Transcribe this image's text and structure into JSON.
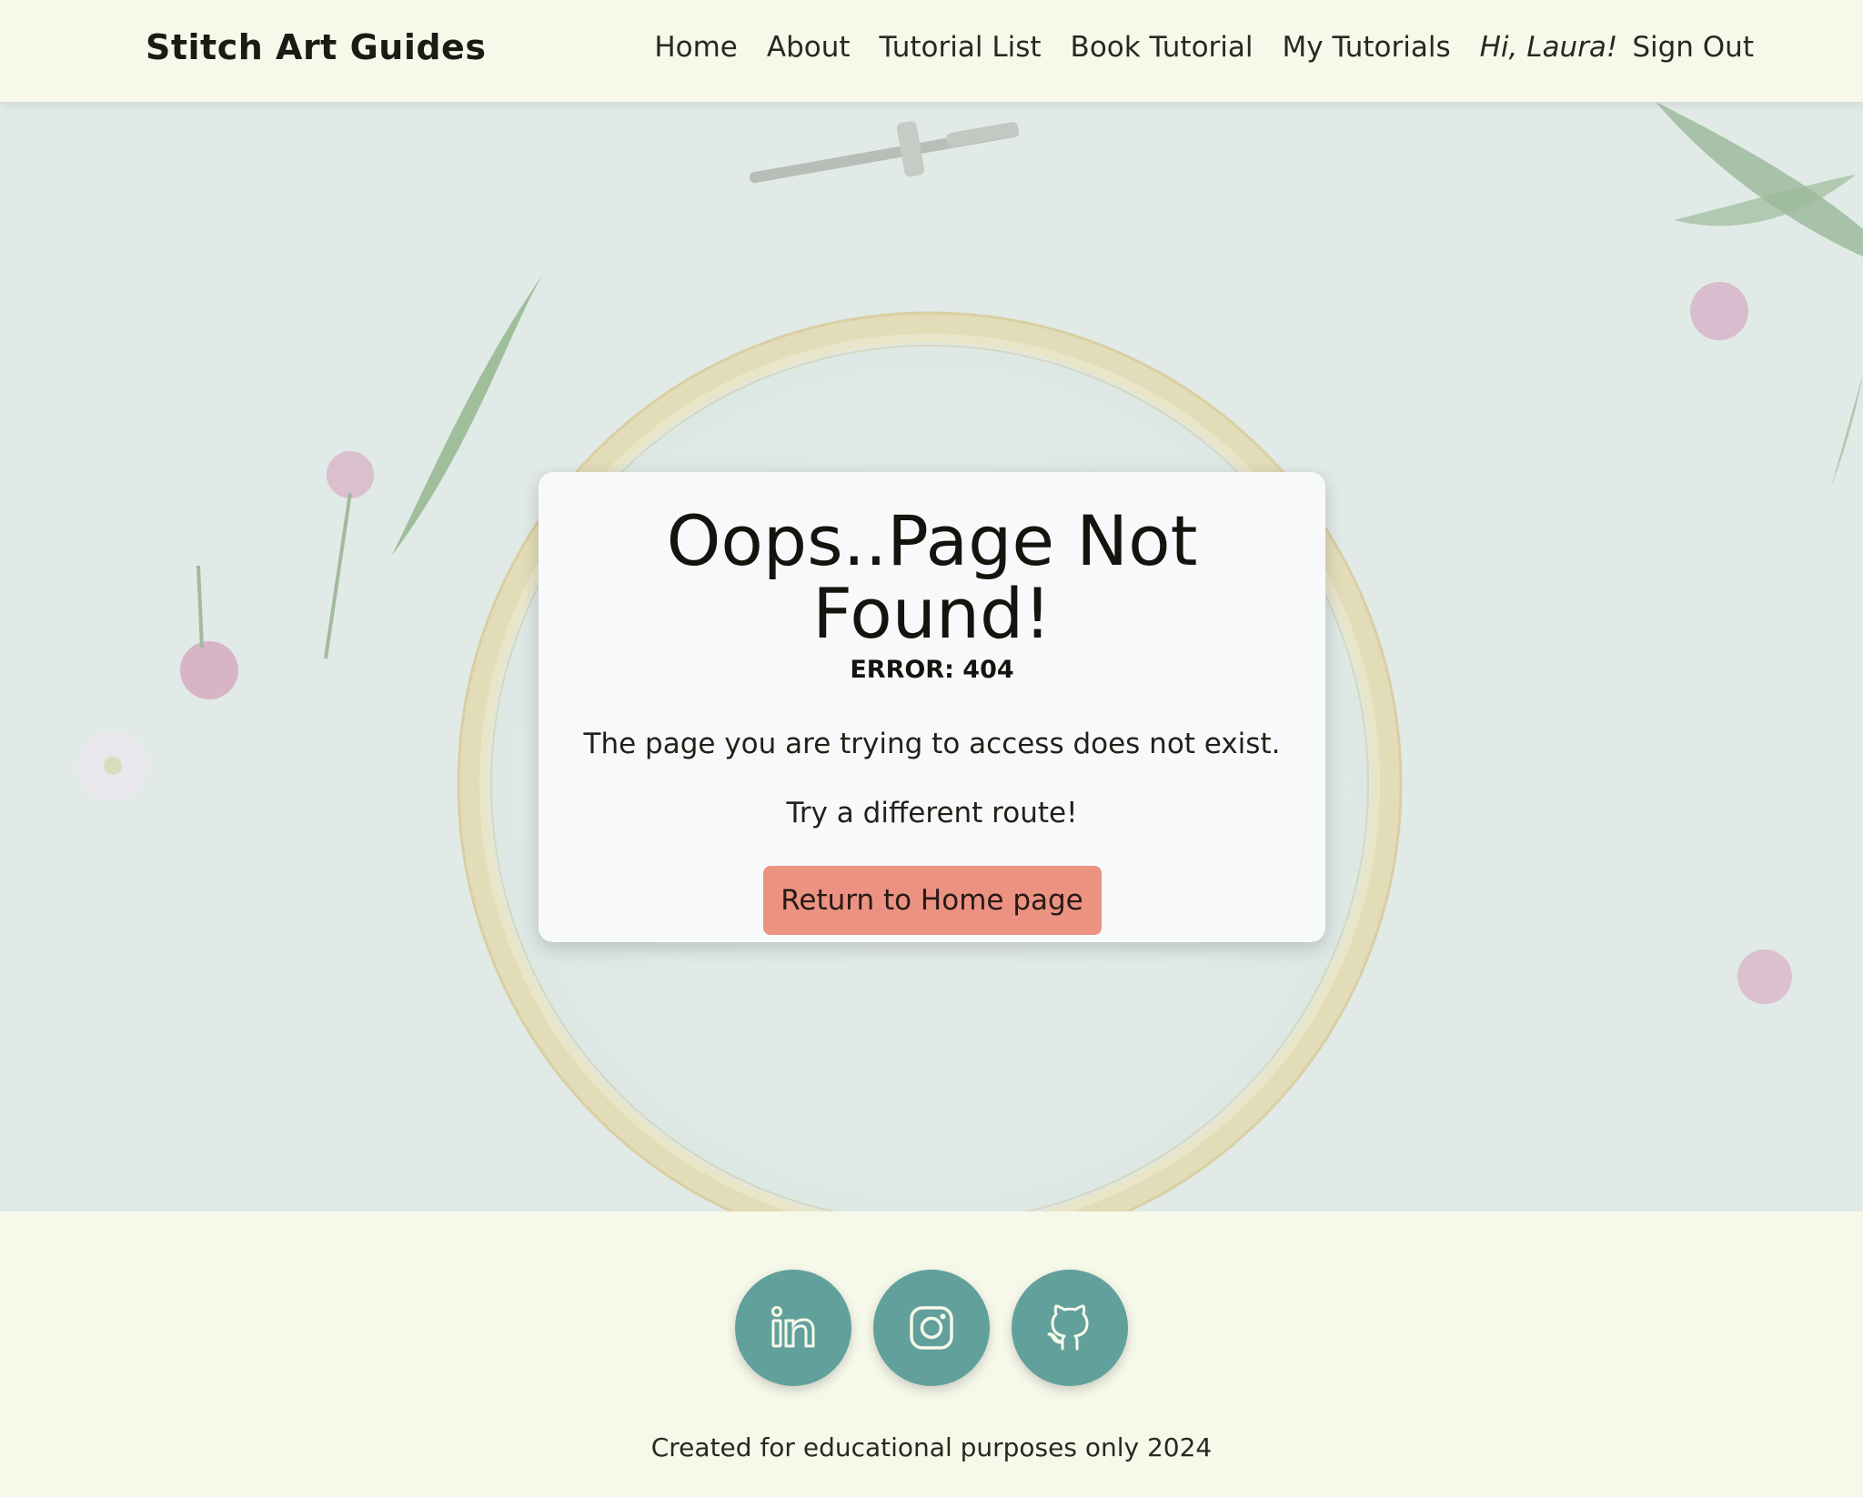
{
  "navbar": {
    "brand": "Stitch Art Guides",
    "links": [
      "Home",
      "About",
      "Tutorial List",
      "Book Tutorial",
      "My Tutorials"
    ],
    "greeting": "Hi, Laura!",
    "signout": "Sign Out"
  },
  "error": {
    "title": "Oops..Page Not Found!",
    "code": "ERROR: 404",
    "message": "The page you are trying to access does not exist.",
    "suggestion": "Try a different route!",
    "button": "Return to Home page"
  },
  "footer": {
    "socials": [
      "linkedin-icon",
      "instagram-icon",
      "github-icon"
    ],
    "text": "Created for educational purposes only 2024"
  },
  "colors": {
    "background": "#f6f9ea",
    "accent_button": "#ec9283",
    "social": "#62a09b",
    "hero": "#e2ebe8"
  }
}
